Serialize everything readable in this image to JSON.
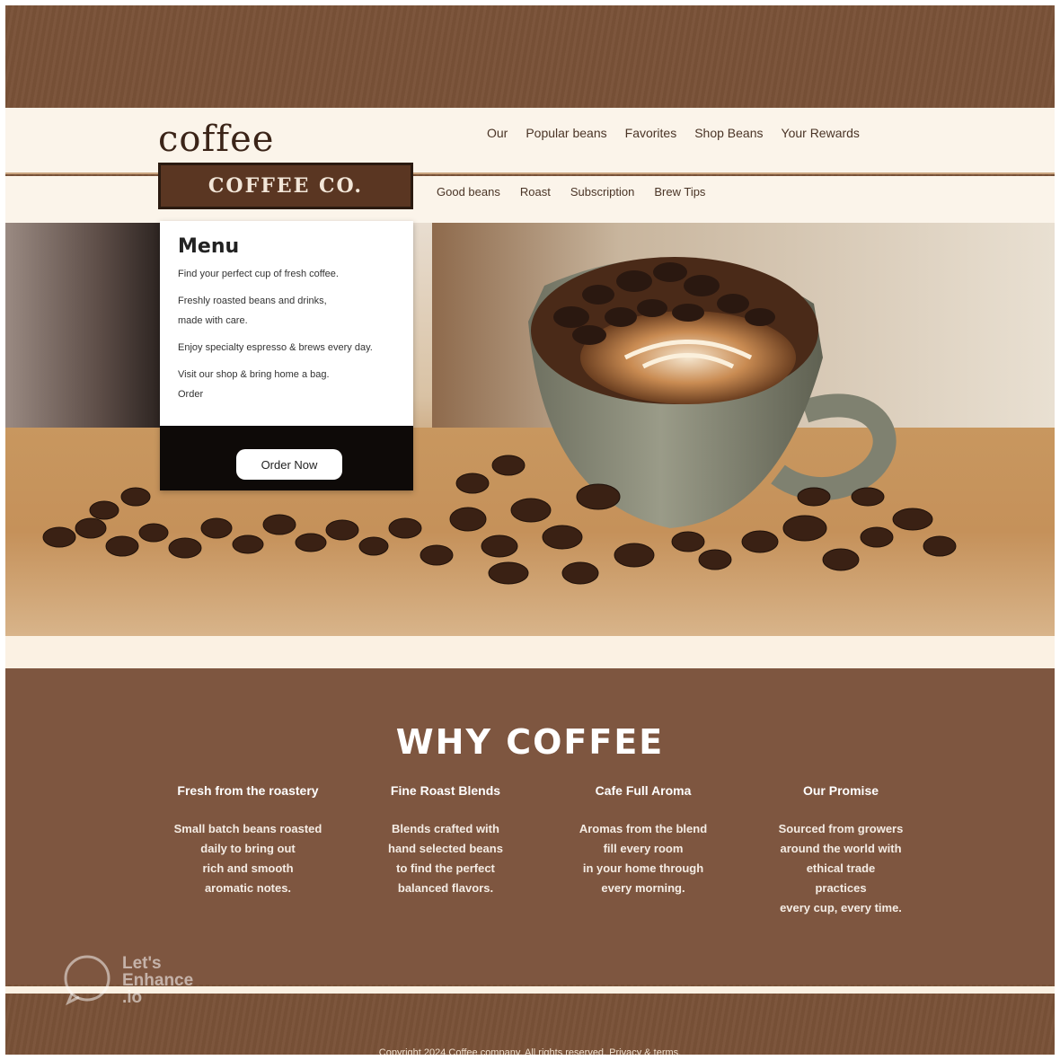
{
  "header": {
    "logo": "coffee",
    "nav": [
      "Our",
      "Popular beans",
      "Favorites",
      "Shop Beans",
      "Your Rewards"
    ]
  },
  "subheader": {
    "brand_band": "COFFEE CO.",
    "nav": [
      "Good beans",
      "Roast",
      "Subscription",
      "Brew Tips"
    ]
  },
  "hero_card": {
    "title": "Menu",
    "lines": [
      "Find your perfect cup of fresh coffee.",
      "Freshly roasted beans and drinks,",
      "made with care.",
      "Enjoy specialty espresso & brews every day.",
      "Visit our shop & bring home a bag.",
      "Order"
    ],
    "button": "Order Now"
  },
  "why": {
    "title": "WHY COFFEE",
    "columns": [
      {
        "heading": "Fresh from the roastery",
        "body": [
          "Small batch beans roasted",
          "daily to bring out",
          "rich and smooth",
          "aromatic notes."
        ]
      },
      {
        "heading": "Fine Roast Blends",
        "body": [
          "Blends crafted with",
          "hand selected beans",
          "to find the perfect",
          "balanced flavors."
        ]
      },
      {
        "heading": "Cafe Full Aroma",
        "body": [
          "Aromas from the blend",
          "fill every room",
          "in your home through",
          "every morning."
        ]
      },
      {
        "heading": "Our Promise",
        "body": [
          "Sourced from growers",
          "around the world with",
          "ethical trade",
          "practices",
          "every cup, every time."
        ]
      }
    ]
  },
  "footer": {
    "text": "Copyright 2024 Coffee company. All rights reserved. Privacy & terms."
  },
  "watermark": {
    "line1": "Let's",
    "line2": "Enhance",
    "line3": ".io"
  },
  "colors": {
    "frame": "#7a5238",
    "cream": "#fbf4ea",
    "section": "#7e5640",
    "card_foot": "#0e0a08"
  }
}
